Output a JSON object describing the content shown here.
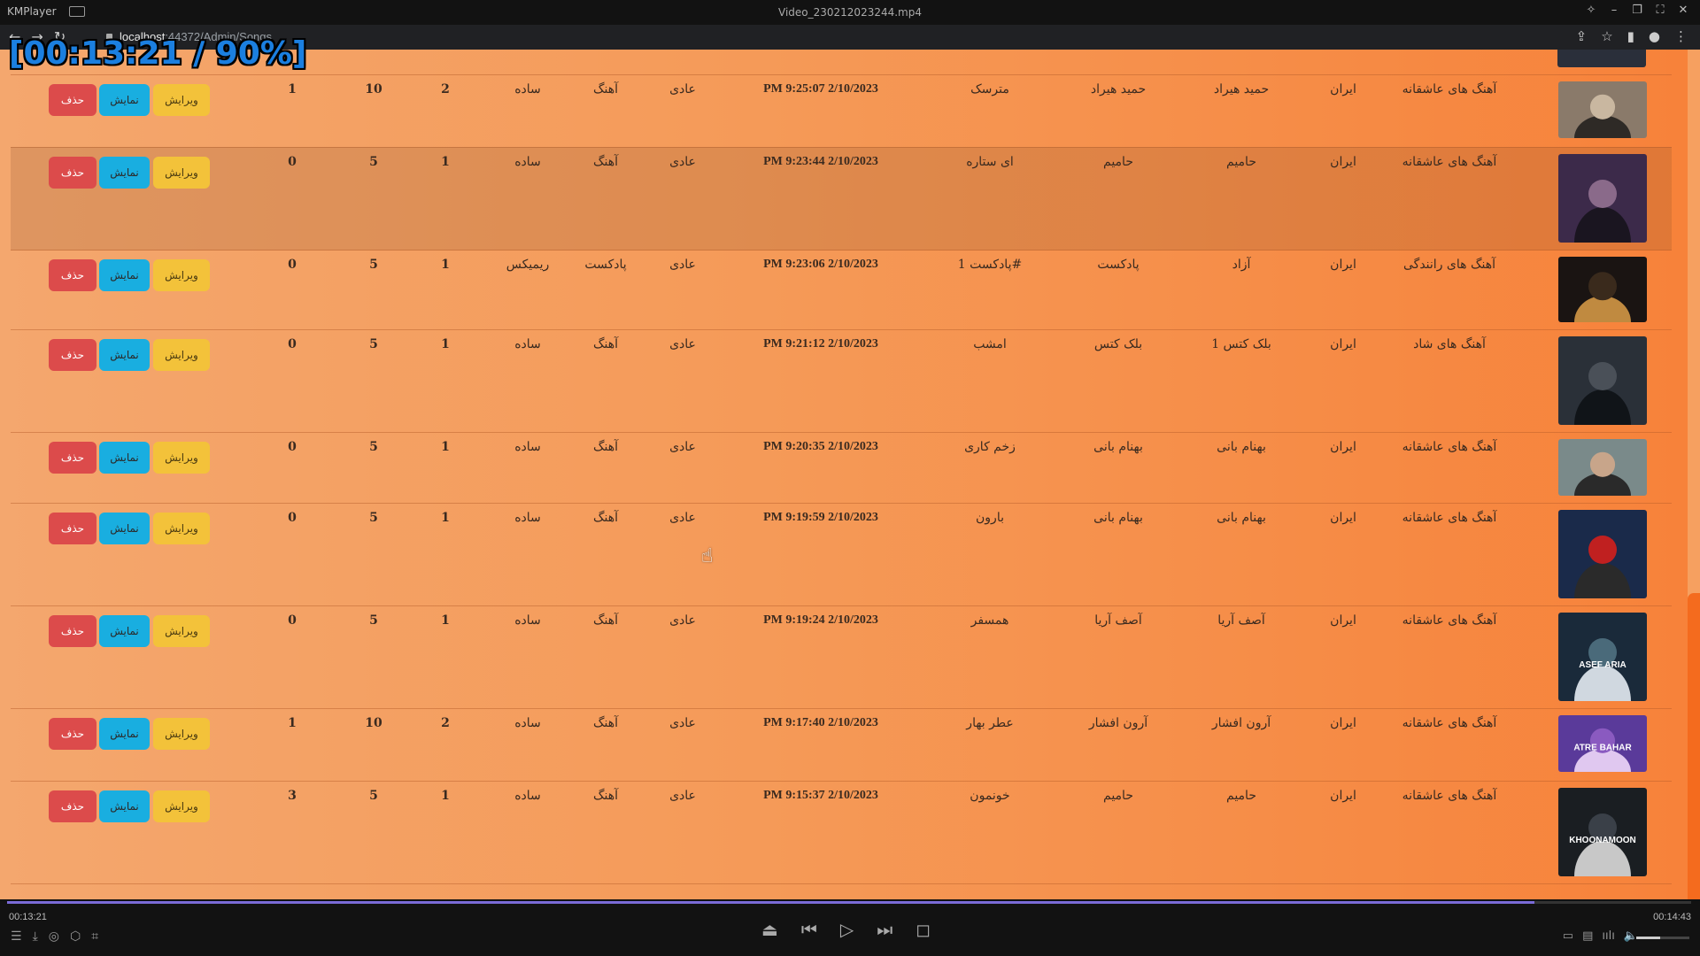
{
  "player": {
    "app_name": "KMPlayer",
    "file_name": "Video_230212023244.mp4",
    "overlay": "[00:13:21 / 90%]",
    "elapsed": "00:13:21",
    "total": "00:14:43",
    "progress_fraction": 0.907,
    "volume_fraction": 0.45
  },
  "browser": {
    "url_host": "localhost",
    "url_rest": ":44372/Admin/Songs"
  },
  "buttons": {
    "delete": "حذف",
    "show": "نمایش",
    "edit": "ویرایش"
  },
  "rows": [
    {
      "c1": "1",
      "c2": "10",
      "c3": "2",
      "mode": "ساده",
      "type": "آهنگ",
      "level": "عادی",
      "date": "PM 9:25:07 2/10/2023",
      "title": "مترسک",
      "artist": "حمید هیراد",
      "singer": "حمید هیراد",
      "country": "ایران",
      "category": "آهنگ های عاشقانه",
      "thumb": "thumb-man-brick"
    },
    {
      "c1": "0",
      "c2": "5",
      "c3": "1",
      "mode": "ساده",
      "type": "آهنگ",
      "level": "عادی",
      "date": "PM 9:23:44 2/10/2023",
      "title": "ای ستاره",
      "artist": "حامیم",
      "singer": "حامیم",
      "country": "ایران",
      "category": "آهنگ های عاشقانه",
      "thumb": "thumb-man-purple"
    },
    {
      "c1": "0",
      "c2": "5",
      "c3": "1",
      "mode": "ریمیکس",
      "type": "پادکست",
      "level": "عادی",
      "date": "PM 9:23:06 2/10/2023",
      "title": "پادکست 1#",
      "artist": "پادکست",
      "singer": "آزاد",
      "country": "ایران",
      "category": "آهنگ های رانندگی",
      "thumb": "thumb-guitar"
    },
    {
      "c1": "0",
      "c2": "5",
      "c3": "1",
      "mode": "ساده",
      "type": "آهنگ",
      "level": "عادی",
      "date": "PM 9:21:12 2/10/2023",
      "title": "امشب",
      "artist": "بلک کتس",
      "singer": "بلک کتس 1",
      "country": "ایران",
      "category": "آهنگ های شاد",
      "thumb": "thumb-band"
    },
    {
      "c1": "0",
      "c2": "5",
      "c3": "1",
      "mode": "ساده",
      "type": "آهنگ",
      "level": "عادی",
      "date": "PM 9:20:35 2/10/2023",
      "title": "زخم کاری",
      "artist": "بهنام بانی",
      "singer": "بهنام بانی",
      "country": "ایران",
      "category": "آهنگ های عاشقانه",
      "thumb": "thumb-man-glasses"
    },
    {
      "c1": "0",
      "c2": "5",
      "c3": "1",
      "mode": "ساده",
      "type": "آهنگ",
      "level": "عادی",
      "date": "PM 9:19:59 2/10/2023",
      "title": "بارون",
      "artist": "بهنام بانی",
      "singer": "بهنام بانی",
      "country": "ایران",
      "category": "آهنگ های عاشقانه",
      "thumb": "thumb-man-red"
    },
    {
      "c1": "0",
      "c2": "5",
      "c3": "1",
      "mode": "ساده",
      "type": "آهنگ",
      "level": "عادی",
      "date": "PM 9:19:24 2/10/2023",
      "title": "همسفر",
      "artist": "آصف آریا",
      "singer": "آصف آریا",
      "country": "ایران",
      "category": "آهنگ های عاشقانه",
      "thumb": "thumb-asef-aria",
      "thumb_text": "ASEF ARIA"
    },
    {
      "c1": "1",
      "c2": "10",
      "c3": "2",
      "mode": "ساده",
      "type": "آهنگ",
      "level": "عادی",
      "date": "PM 9:17:40 2/10/2023",
      "title": "عطر بهار",
      "artist": "آرون افشار",
      "singer": "آرون افشار",
      "country": "ایران",
      "category": "آهنگ های عاشقانه",
      "thumb": "thumb-atre-bahar",
      "thumb_text": "ATRE BAHAR"
    },
    {
      "c1": "3",
      "c2": "5",
      "c3": "1",
      "mode": "ساده",
      "type": "آهنگ",
      "level": "عادی",
      "date": "PM 9:15:37 2/10/2023",
      "title": "خونمون",
      "artist": "حامیم",
      "singer": "حامیم",
      "country": "ایران",
      "category": "آهنگ های عاشقانه",
      "thumb": "thumb-khoonamoon",
      "thumb_text": "KHOONAMOON"
    }
  ]
}
